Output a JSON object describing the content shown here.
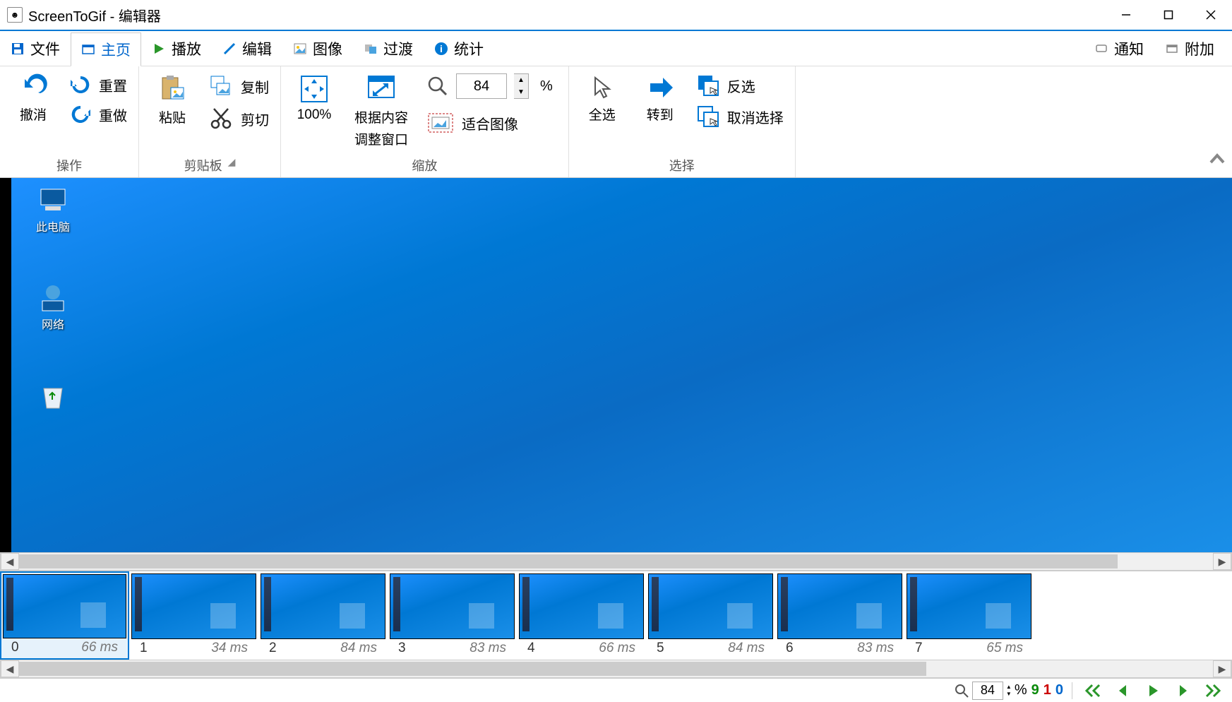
{
  "titlebar": {
    "title": "ScreenToGif - 编辑器"
  },
  "tabs": {
    "file": "文件",
    "home": "主页",
    "play": "播放",
    "edit": "编辑",
    "image": "图像",
    "transition": "过渡",
    "stats": "统计",
    "notify": "通知",
    "extras": "附加"
  },
  "ribbon": {
    "ops": {
      "label": "操作",
      "undo": "撤消",
      "reset": "重置",
      "redo": "重做"
    },
    "clip": {
      "label": "剪贴板",
      "paste": "粘贴",
      "copy": "复制",
      "cut": "剪切"
    },
    "zoom": {
      "label": "缩放",
      "hundred": "100%",
      "fitWindow1": "根据内容",
      "fitWindow2": "调整窗口",
      "fitImage": "适合图像",
      "value": "84",
      "pct": "%"
    },
    "select": {
      "label": "选择",
      "all": "全选",
      "goto": "转到",
      "inverse": "反选",
      "deselect": "取消选择"
    }
  },
  "preview": {
    "icon1": "此电脑",
    "icon2": "网络"
  },
  "frames": [
    {
      "idx": "0",
      "ms": "66 ms"
    },
    {
      "idx": "1",
      "ms": "34 ms"
    },
    {
      "idx": "2",
      "ms": "84 ms"
    },
    {
      "idx": "3",
      "ms": "83 ms"
    },
    {
      "idx": "4",
      "ms": "66 ms"
    },
    {
      "idx": "5",
      "ms": "84 ms"
    },
    {
      "idx": "6",
      "ms": "83 ms"
    },
    {
      "idx": "7",
      "ms": "65 ms"
    }
  ],
  "status": {
    "zoom": "84",
    "pct": "%",
    "n1": "9",
    "n2": "1",
    "n3": "0"
  }
}
